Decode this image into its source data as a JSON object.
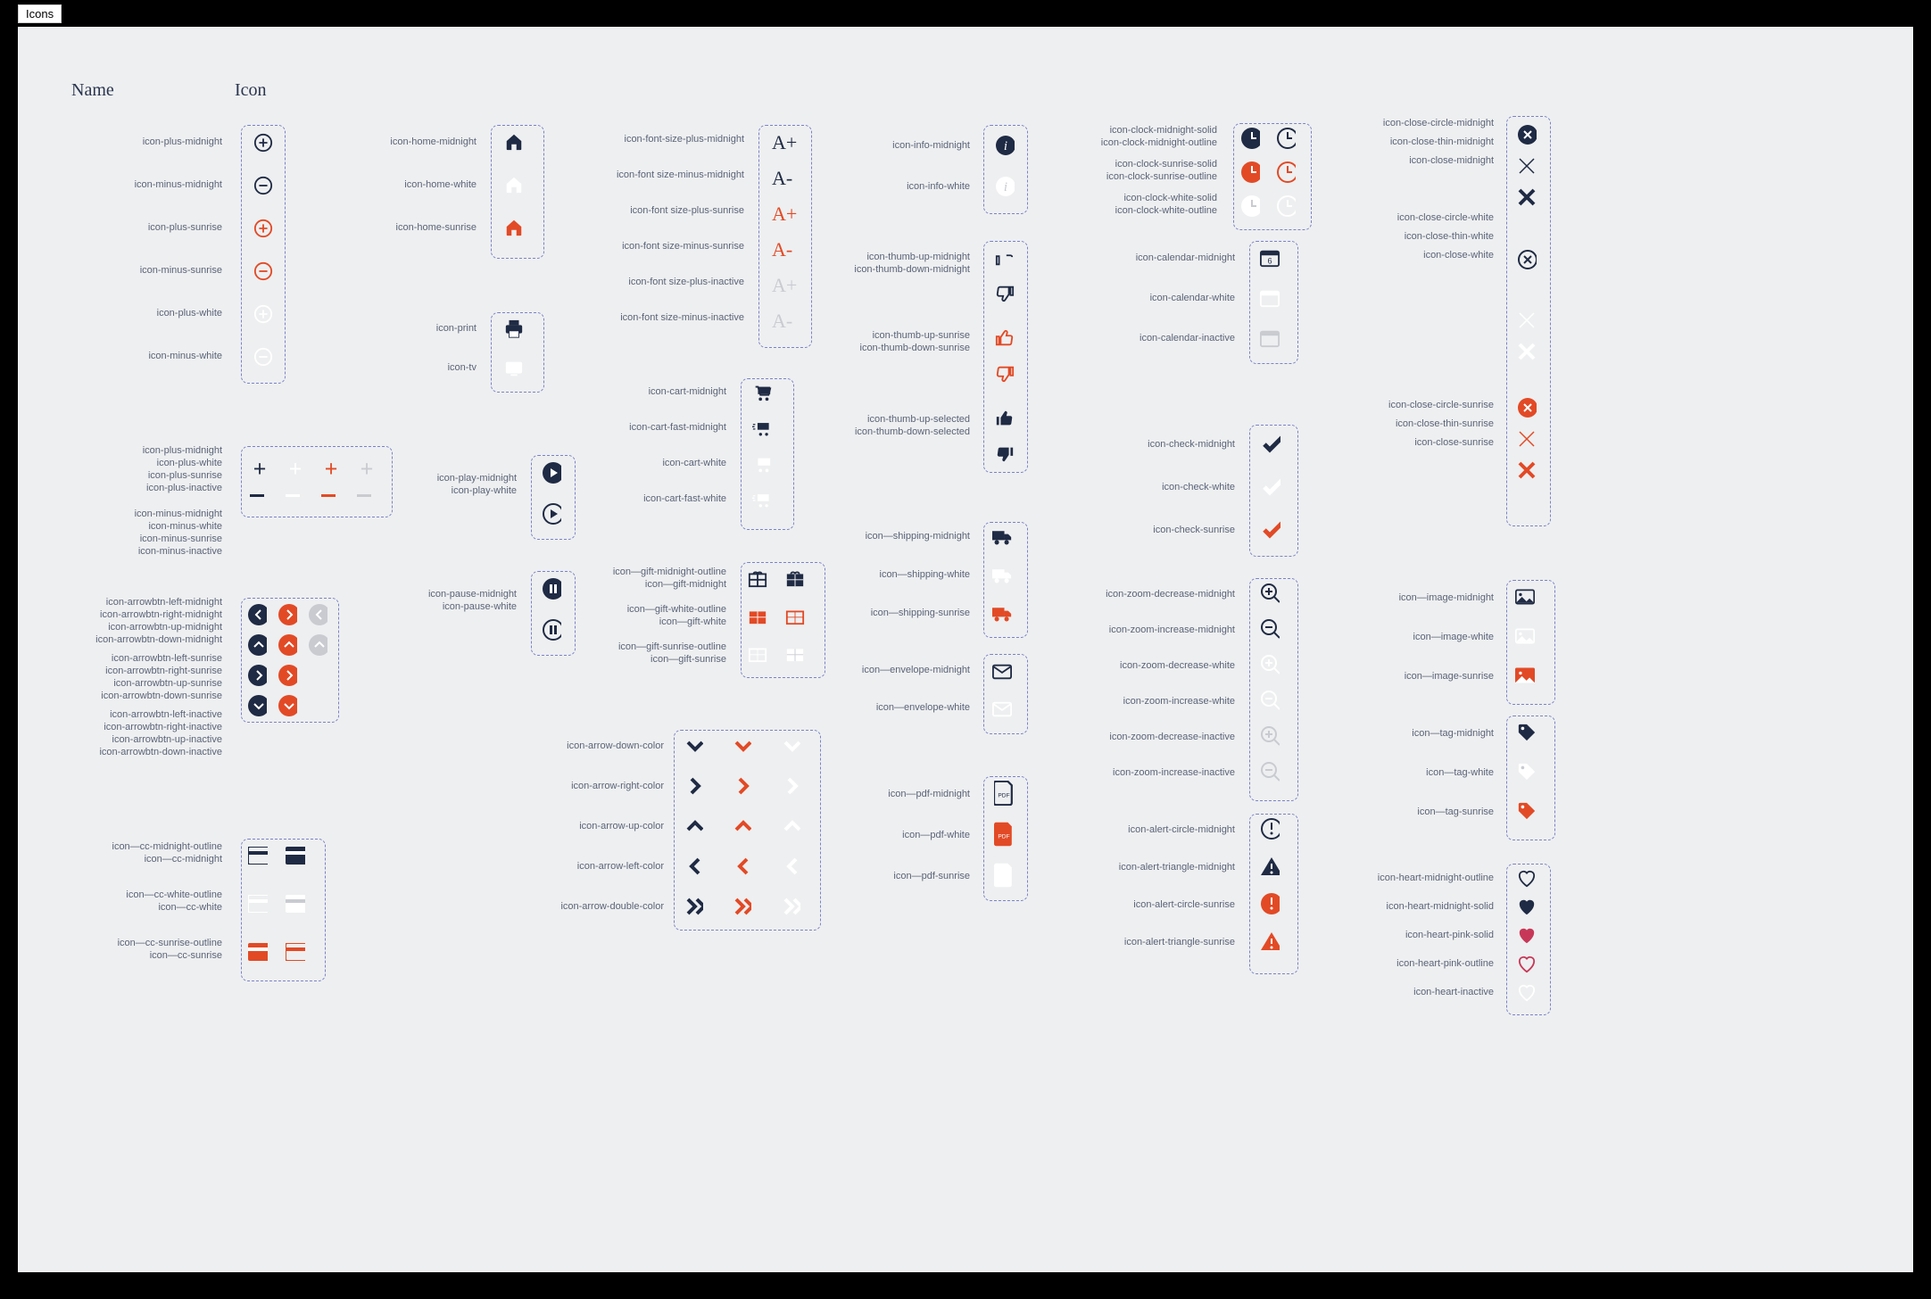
{
  "tab": "Icons",
  "headers": {
    "name": "Name",
    "icon": "Icon"
  },
  "labels": {
    "plus_midnight": "icon-plus-midnight",
    "minus_midnight": "icon-minus-midnight",
    "plus_sunrise": "icon-plus-sunrise",
    "minus_sunrise": "icon-minus-sunrise",
    "plus_white": "icon-plus-white",
    "minus_white": "icon-minus-white",
    "plus_midnight2": "icon-plus-midnight",
    "plus_white2": "icon-plus-white",
    "plus_sunrise2": "icon-plus-sunrise",
    "plus_inactive": "icon-plus-inactive",
    "minus_midnight2": "icon-minus-midnight",
    "minus_white2": "icon-minus-white",
    "minus_sunrise2": "icon-minus-sunrise",
    "minus_inactive": "icon-minus-inactive",
    "abl_m": "icon-arrowbtn-left-midnight",
    "abr_m": "icon-arrowbtn-right-midnight",
    "abu_m": "icon-arrowbtn-up-midnight",
    "abd_m": "icon-arrowbtn-down-midnight",
    "abl_s": "icon-arrowbtn-left-sunrise",
    "abr_s": "icon-arrowbtn-right-sunrise",
    "abu_s": "icon-arrowbtn-up-sunrise",
    "abd_s": "icon-arrowbtn-down-sunrise",
    "abl_i": "icon-arrowbtn-left-inactive",
    "abr_i": "icon-arrowbtn-right-inactive",
    "abu_i": "icon-arrowbtn-up-inactive",
    "abd_i": "icon-arrowbtn-down-inactive",
    "cc_mo": "icon—cc-midnight-outline",
    "cc_m": "icon—cc-midnight",
    "cc_wo": "icon—cc-white-outline",
    "cc_w": "icon—cc-white",
    "cc_so": "icon—cc-sunrise-outline",
    "cc_s": "icon—cc-sunrise",
    "home_m": "icon-home-midnight",
    "home_w": "icon-home-white",
    "home_s": "icon-home-sunrise",
    "print": "icon-print",
    "tv": "icon-tv",
    "play_m": "icon-play-midnight",
    "play_w": "icon-play-white",
    "pause_m": "icon-pause-midnight",
    "pause_w": "icon-pause-white",
    "fsp_m": "icon-font-size-plus-midnight",
    "fsm_m": "icon-font size-minus-midnight",
    "fsp_s": "icon-font size-plus-sunrise",
    "fsm_s": "icon-font size-minus-sunrise",
    "fsp_i": "icon-font size-plus-inactive",
    "fsm_i": "icon-font size-minus-inactive",
    "cart_m": "icon-cart-midnight",
    "cart_fm": "icon-cart-fast-midnight",
    "cart_w": "icon-cart-white",
    "cart_fw": "icon-cart-fast-white",
    "gift_mo": "icon—gift-midnight-outline",
    "gift_m": "icon—gift-midnight",
    "gift_wo": "icon—gift-white-outline",
    "gift_w": "icon—gift-white",
    "gift_so": "icon—gift-sunrise-outline",
    "gift_s": "icon—gift-sunrise",
    "ad": "icon-arrow-down-color",
    "ar": "icon-arrow-right-color",
    "au": "icon-arrow-up-color",
    "al": "icon-arrow-left-color",
    "add": "icon-arrow-double-color",
    "info_m": "icon-info-midnight",
    "info_w": "icon-info-white",
    "tu_m": "icon-thumb-up-midnight",
    "td_m": "icon-thumb-down-midnight",
    "tu_s": "icon-thumb-up-sunrise",
    "td_s": "icon-thumb-down-sunrise",
    "tu_sel": "icon-thumb-up-selected",
    "td_sel": "icon-thumb-down-selected",
    "ship_m": "icon—shipping-midnight",
    "ship_w": "icon—shipping-white",
    "ship_s": "icon—shipping-sunrise",
    "env_m": "icon—envelope-midnight",
    "env_w": "icon—envelope-white",
    "pdf_m": "icon—pdf-midnight",
    "pdf_w": "icon—pdf-white",
    "pdf_s": "icon—pdf-sunrise",
    "clk_ms": "icon-clock-midnight-solid",
    "clk_mo": "icon-clock-midnight-outline",
    "clk_ss": "icon-clock-sunrise-solid",
    "clk_so": "icon-clock-sunrise-outline",
    "clk_ws": "icon-clock-white-solid",
    "clk_wo": "icon-clock-white-outline",
    "cal_m": "icon-calendar-midnight",
    "cal_w": "icon-calendar-white",
    "cal_i": "icon-calendar-inactive",
    "chk_m": "icon-check-midnight",
    "chk_w": "icon-check-white",
    "chk_s": "icon-check-sunrise",
    "zd_m": "icon-zoom-decrease-midnight",
    "zi_m": "icon-zoom-increase-midnight",
    "zd_w": "icon-zoom-decrease-white",
    "zi_w": "icon-zoom-increase-white",
    "zd_i": "icon-zoom-decrease-inactive",
    "zi_i": "icon-zoom-increase-inactive",
    "alc_m": "icon-alert-circle-midnight",
    "alt_m": "icon-alert-triangle-midnight",
    "alc_s": "icon-alert-circle-sunrise",
    "alt_s": "icon-alert-triangle-sunrise",
    "xc_m": "icon-close-circle-midnight",
    "xt_m": "icon-close-thin-midnight",
    "x_m": "icon-close-midnight",
    "xc_w": "icon-close-circle-white",
    "xt_w": "icon-close-thin-white",
    "x_w": "icon-close-white",
    "xc_s": "icon-close-circle-sunrise",
    "xt_s": "icon-close-thin-sunrise",
    "x_s": "icon-close-sunrise",
    "img_m": "icon—image-midnight",
    "img_w": "icon—image-white",
    "img_s": "icon—image-sunrise",
    "tag_m": "icon—tag-midnight",
    "tag_w": "icon—tag-white",
    "tag_s": "icon—tag-sunrise",
    "h_mo": "icon-heart-midnight-outline",
    "h_ms": "icon-heart-midnight-solid",
    "h_ps": "icon-heart-pink-solid",
    "h_po": "icon-heart-pink-outline",
    "h_i": "icon-heart-inactive",
    "A+": "A+",
    "A-": "A-"
  }
}
